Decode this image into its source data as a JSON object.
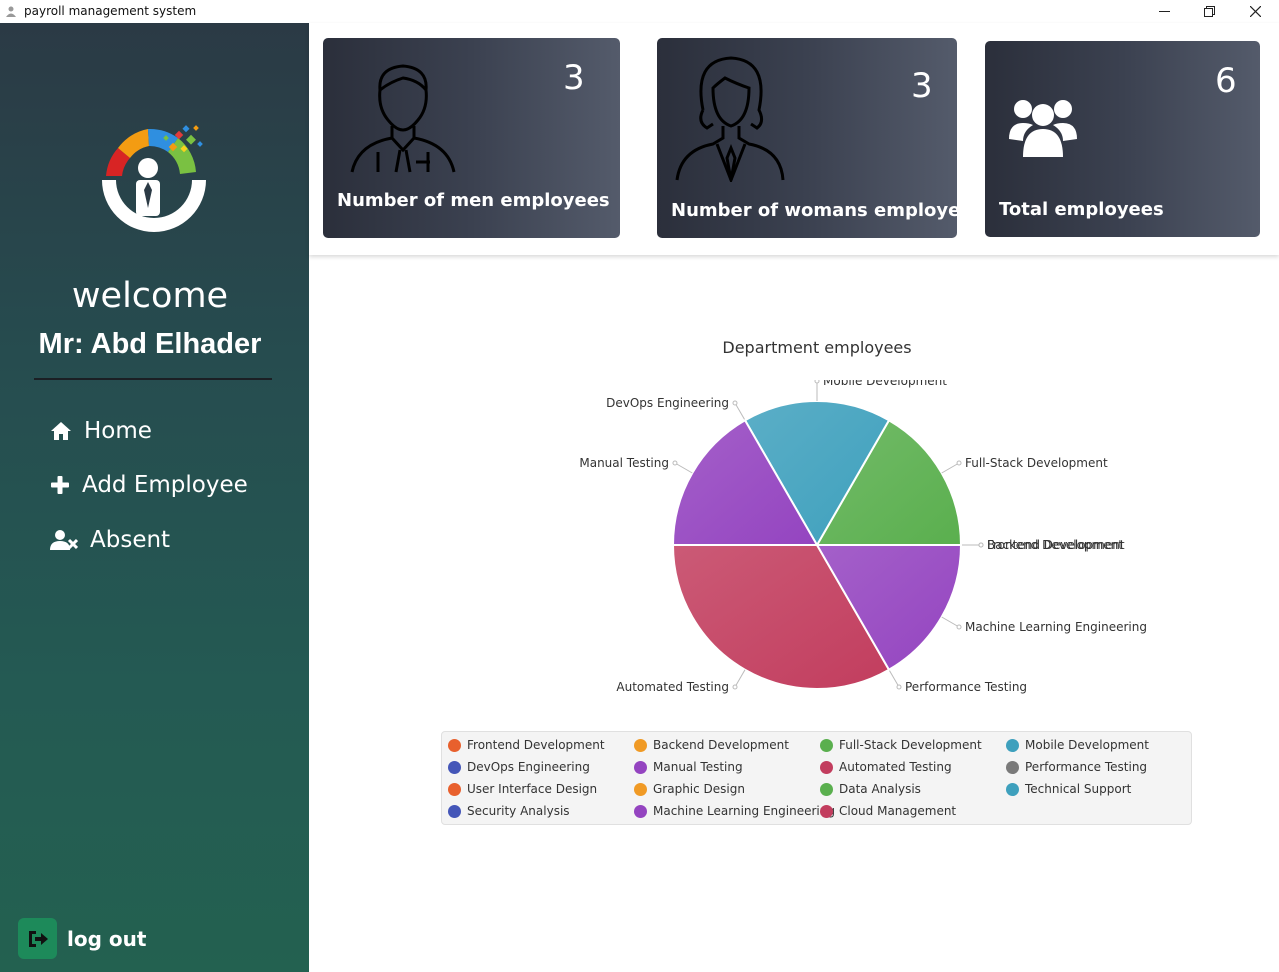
{
  "window": {
    "title": "payroll management system"
  },
  "sidebar": {
    "welcome": "welcome",
    "user": "Mr: Abd Elhader",
    "nav": [
      {
        "label": "Home",
        "icon": "home-icon"
      },
      {
        "label": "Add Employee",
        "icon": "plus-icon"
      },
      {
        "label": "Absent",
        "icon": "user-x-icon"
      }
    ],
    "logout": "log out"
  },
  "cards": [
    {
      "count": "3",
      "label": "Number of men employees",
      "icon": "man-icon"
    },
    {
      "count": "3",
      "label": "Number of womans employees",
      "icon": "woman-icon"
    },
    {
      "count": "6",
      "label": "Total employees",
      "icon": "users-icon"
    }
  ],
  "chart_data": {
    "type": "pie",
    "title": "Department employees",
    "slices": [
      {
        "label": "Frontend Development",
        "value": 0,
        "color": "#e8602d"
      },
      {
        "label": "Backend Development",
        "value": 0,
        "color": "#f09a25"
      },
      {
        "label": "Full-Stack Development",
        "value": 1,
        "color": "#5aaf4e"
      },
      {
        "label": "Mobile Development",
        "value": 1,
        "color": "#3ea0bd"
      },
      {
        "label": "DevOps Engineering",
        "value": 0,
        "color": "#4456b8"
      },
      {
        "label": "Manual Testing",
        "value": 1,
        "color": "#9444c0"
      },
      {
        "label": "Automated Testing",
        "value": 2,
        "color": "#c23d5e"
      },
      {
        "label": "Performance Testing",
        "value": 0,
        "color": "#7a7a7a"
      },
      {
        "label": "Machine Learning Engineering",
        "value": 1,
        "color": "#9444c0"
      }
    ],
    "legend": [
      {
        "label": "Frontend Development",
        "color": "#e8602d"
      },
      {
        "label": "Backend Development",
        "color": "#f09a25"
      },
      {
        "label": "Full-Stack Development",
        "color": "#5aaf4e"
      },
      {
        "label": "Mobile Development",
        "color": "#3ea0bd"
      },
      {
        "label": "DevOps Engineering",
        "color": "#4456b8"
      },
      {
        "label": "Manual Testing",
        "color": "#9444c0"
      },
      {
        "label": "Automated Testing",
        "color": "#c23d5e"
      },
      {
        "label": "Performance Testing",
        "color": "#7a7a7a"
      },
      {
        "label": "User Interface Design",
        "color": "#e8602d"
      },
      {
        "label": "Graphic Design",
        "color": "#f09a25"
      },
      {
        "label": "Data Analysis",
        "color": "#5aaf4e"
      },
      {
        "label": "Technical Support",
        "color": "#3ea0bd"
      },
      {
        "label": "Security Analysis",
        "color": "#4456b8"
      },
      {
        "label": "Machine Learning Engineering",
        "color": "#9444c0"
      },
      {
        "label": "Cloud Management",
        "color": "#c23d5e"
      }
    ],
    "legend_position": "bottom"
  }
}
